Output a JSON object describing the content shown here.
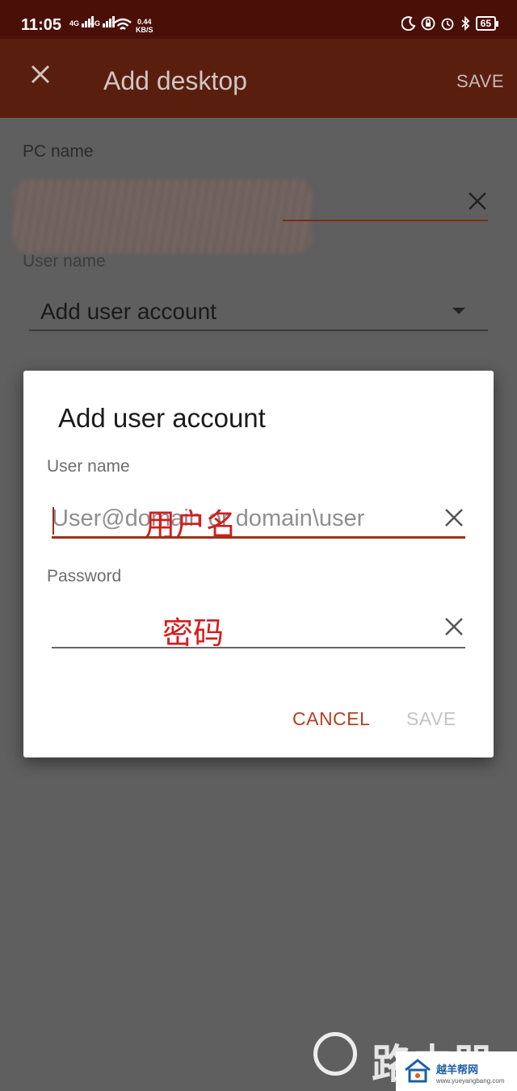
{
  "status_bar": {
    "time": "11:05",
    "sim1": "4G",
    "sim2": "4G",
    "speed_value": "0.44",
    "speed_unit": "KB/S",
    "battery": "65"
  },
  "appbar": {
    "title": "Add desktop",
    "save_label": "SAVE"
  },
  "form": {
    "pc_name_label": "PC name",
    "user_name_label": "User name",
    "account_value": "Add user account"
  },
  "dialog": {
    "title": "Add user account",
    "username_label": "User name",
    "username_placeholder": "User@domain or domain\\user",
    "username_annotation": "用户名",
    "password_label": "Password",
    "password_annotation": "密码",
    "cancel_label": "CANCEL",
    "save_label": "SAVE"
  },
  "watermark": {
    "text": "路由器",
    "site_name": "越羊帮网",
    "site_url": "www.yueyangbang.com"
  },
  "colors": {
    "appbar": "#5a1e0f",
    "accent": "#9a3319",
    "annotation": "#d41c1c"
  }
}
